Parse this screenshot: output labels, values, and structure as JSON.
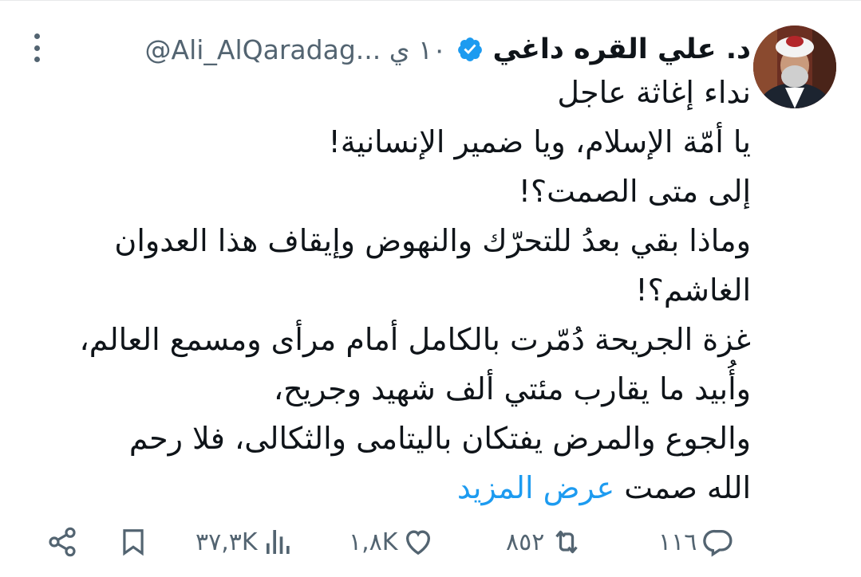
{
  "tweet": {
    "author_name": "د. علي القره داغي",
    "handle": "@Ali_AlQaradag...",
    "time": "١٠ ي",
    "verified": true,
    "body_lines": [
      "نداء إغاثة عاجل",
      "يا أمّة الإسلام، ويا ضمير الإنسانية!",
      "إلى متى الصمت؟!",
      "وماذا بقي بعدُ للتحرّك والنهوض وإيقاف هذا العدوان",
      "الغاشم؟!",
      "غزة الجريحة دُمّرت بالكامل أمام مرأى ومسمع العالم،",
      "وأُبيد ما يقارب مئتي ألف شهيد  وجريح،",
      "والجوع والمرض يفتكان باليتامى والثكالى، فلا رحم"
    ],
    "last_line_text": "الله صمت",
    "show_more": "عرض المزيد"
  },
  "actions": {
    "replies": "١١٦",
    "retweets": "٨٥٢",
    "likes": "١,٨K",
    "views": "٣٧,٣K"
  },
  "colors": {
    "text": "#0f1419",
    "secondary": "#536471",
    "link": "#1d9bf0",
    "verified_badge": "#1d9bf0"
  },
  "icons": [
    "more-icon",
    "verified-icon",
    "reply-icon",
    "retweet-icon",
    "like-icon",
    "views-icon",
    "bookmark-icon",
    "share-icon"
  ]
}
